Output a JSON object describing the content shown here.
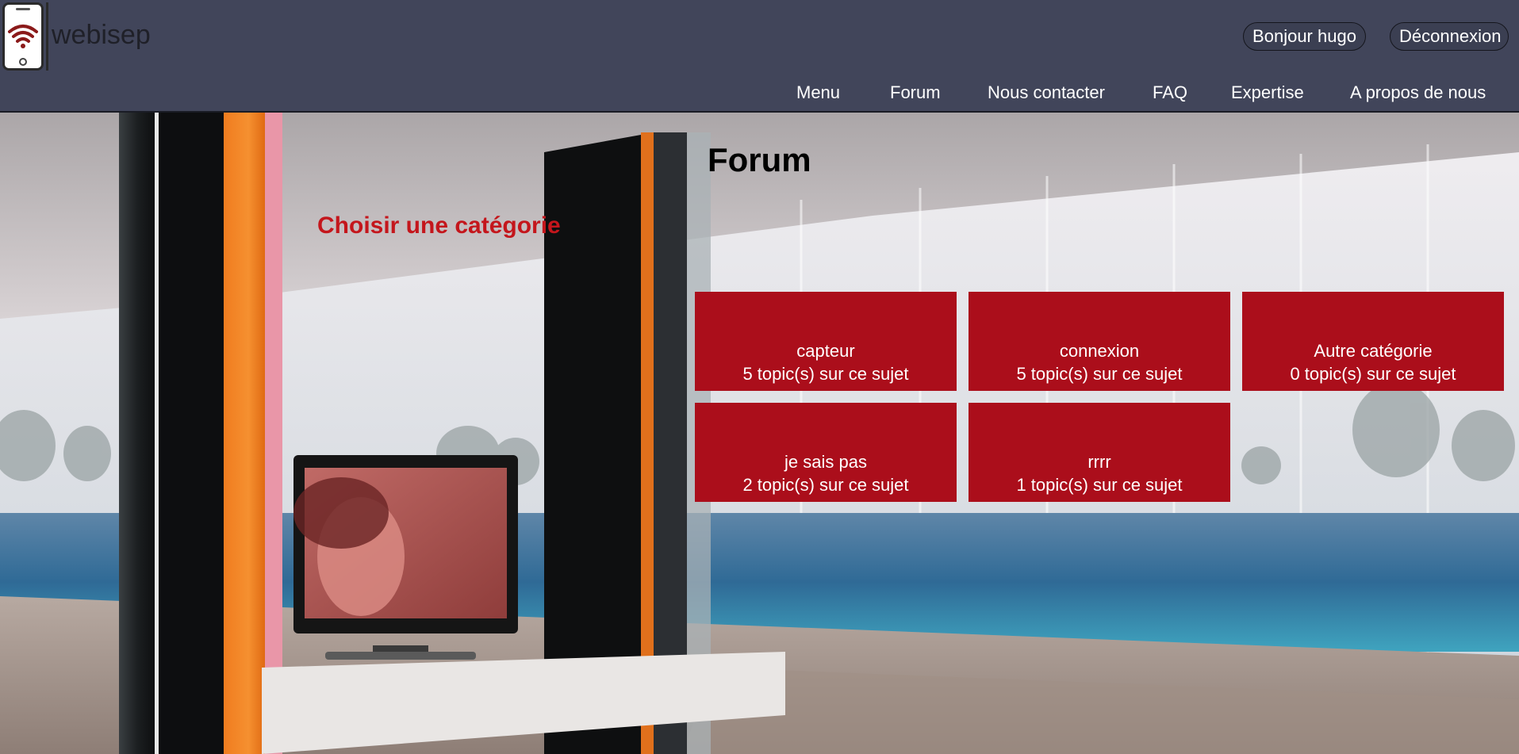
{
  "header": {
    "logo_text": "webisep",
    "user_greeting": "Bonjour hugo",
    "logout_label": "Déconnexion",
    "nav": [
      {
        "label": "Menu"
      },
      {
        "label": "Forum"
      },
      {
        "label": "Nous contacter"
      },
      {
        "label": "FAQ"
      },
      {
        "label": "Expertise"
      },
      {
        "label": "A propos de nous"
      }
    ]
  },
  "main": {
    "title": "Forum",
    "subtitle": "Choisir une catégorie",
    "categories": [
      {
        "name": "capteur",
        "count_text": "5 topic(s) sur ce sujet"
      },
      {
        "name": "connexion",
        "count_text": "5 topic(s) sur ce sujet"
      },
      {
        "name": "Autre catégorie",
        "count_text": "0 topic(s) sur ce sujet"
      },
      {
        "name": "je sais pas",
        "count_text": "2 topic(s) sur ce sujet"
      },
      {
        "name": "rrrr",
        "count_text": "1 topic(s) sur ce sujet"
      }
    ]
  },
  "colors": {
    "header_bg": "#41455a",
    "tile_bg": "#ab0e1b",
    "heading_red": "#c4161c",
    "logo_wifi": "#8b1a1a"
  },
  "icons": {
    "logo": "smartphone-wifi-icon"
  }
}
